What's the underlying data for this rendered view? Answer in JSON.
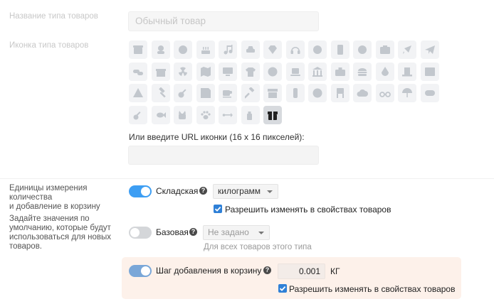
{
  "type_name": {
    "label": "Название типа товаров",
    "placeholder": "Обычный товар"
  },
  "icon_section": {
    "label": "Иконка типа товаров",
    "icons": [
      [
        "box-icon",
        "smiley-icon",
        "face-icon",
        "cake-icon",
        "music-icon",
        "car-icon",
        "diamond-icon",
        "headphones-icon",
        "globe-icon",
        "phone-icon",
        "coin-icon",
        "camera-icon",
        "rocket-icon",
        "paper-plane-icon"
      ],
      [
        "pills-icon",
        "gift-icon",
        "radiation-icon",
        "map-icon",
        "monitor-icon",
        "tshirt-icon",
        "disc-icon",
        "laptop-icon",
        "bank-icon",
        "briefcase-icon",
        "burger-icon",
        "drop-icon",
        "tophat-icon",
        "film-icon"
      ],
      [
        "warning-icon",
        "hammer-icon",
        "guitar-icon",
        "floppy-icon",
        "coffee-icon",
        "gavel-icon",
        "archive-icon",
        "traffic-light-icon",
        "clock-icon",
        "chair-icon",
        "cloud-download-icon",
        "glasses-icon",
        "umbrella-icon",
        "gamepad-icon"
      ],
      [
        "key-icon",
        "fish-icon",
        "cat-icon",
        "paw-icon",
        "usb-icon",
        "spray-icon",
        "package-icon"
      ]
    ],
    "selected_icon": "package-icon"
  },
  "url_field": {
    "label": "Или введите URL иконки (16 x 16 пикселей):",
    "value": ""
  },
  "units_section": {
    "label_line1": "Единицы измерения",
    "label_line2": "количества",
    "label_line3": "и добавление в корзину",
    "desc_line1": "Задайте значения по",
    "desc_line2": "умолчанию, которые будут",
    "desc_line3": "использоваться для новых",
    "desc_line4": "товаров."
  },
  "stock_unit": {
    "label": "Складская",
    "enabled": true,
    "select_value": "килограмм",
    "checkbox_label": "Разрешить изменять в свойствах товаров",
    "checked": true
  },
  "base_unit": {
    "label": "Базовая",
    "enabled": false,
    "select_value": "Не задано",
    "hint": "Для всех товаров этого типа"
  },
  "cart_step": {
    "label": "Шаг добавления в корзину",
    "enabled": true,
    "value": "0.001",
    "unit": "КГ",
    "checkbox_label": "Разрешить изменять в свойствах товаров",
    "checked": true
  },
  "help_glyph": "?",
  "colors": {
    "accent": "#3d9ef3",
    "checkbox": "#2f80d7",
    "highlight_bg": "#fdf1ea"
  }
}
